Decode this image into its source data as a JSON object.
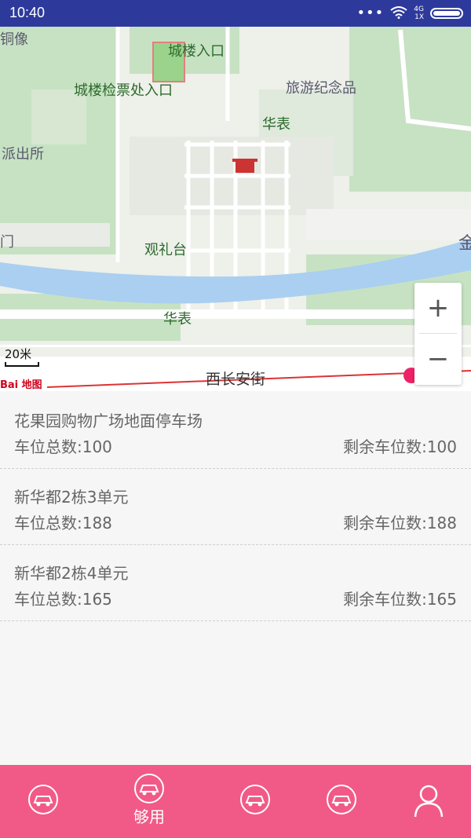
{
  "status_bar": {
    "time": "10:40",
    "network": "4G",
    "network_sub": "1X"
  },
  "map": {
    "labels": {
      "statue": "铜像",
      "gate_entrance": "城楼入口",
      "ticket_entrance": "城楼检票处入口",
      "souvenir": "旅游纪念品",
      "huabiao_top": "华表",
      "police": "派出所",
      "gate_left": "门",
      "viewing_stand": "观礼台",
      "huabiao_bottom": "华表",
      "street": "西长安街",
      "edge_char": "金"
    },
    "scale": "20米",
    "logo": "Bai 地图",
    "zoom_in": "+",
    "zoom_out": "−"
  },
  "parking_list": [
    {
      "name": "花果园购物广场地面停车场",
      "total": "车位总数:100",
      "remaining": "剩余车位数:100"
    },
    {
      "name": "新华都2栋3单元",
      "total": "车位总数:188",
      "remaining": "剩余车位数:188"
    },
    {
      "name": "新华都2栋4单元",
      "total": "车位总数:165",
      "remaining": "剩余车位数:165"
    }
  ],
  "tab_bar": {
    "active_label": "够用",
    "accent": "#f15a87",
    "icons": [
      "car-icon",
      "car-icon",
      "car-icon",
      "car-icon",
      "user-icon"
    ]
  }
}
